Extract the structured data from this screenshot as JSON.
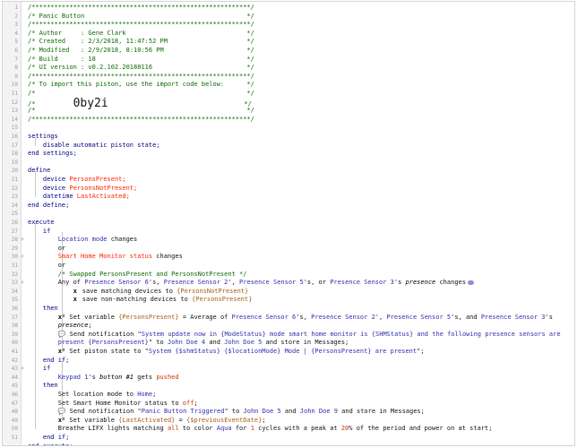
{
  "lines": [
    [
      {
        "c": "c",
        "t": "/**********************************************************/"
      }
    ],
    [
      {
        "c": "c",
        "t": "/* Panic Button                                           */"
      }
    ],
    [
      {
        "c": "c",
        "t": "/**********************************************************/"
      }
    ],
    [
      {
        "c": "c",
        "t": "/* Author     : Gene Clark                                */"
      }
    ],
    [
      {
        "c": "c",
        "t": "/* Created    : 2/3/2018, 11:47:52 PM                     */"
      }
    ],
    [
      {
        "c": "c",
        "t": "/* Modified   : 2/9/2018, 8:10:56 PM                      */"
      }
    ],
    [
      {
        "c": "c",
        "t": "/* Build      : 18                                        */"
      }
    ],
    [
      {
        "c": "c",
        "t": "/* UI version : v0.2.102.20180116                         */"
      }
    ],
    [
      {
        "c": "c",
        "t": "/**********************************************************/"
      }
    ],
    [
      {
        "c": "c",
        "t": "/* To import this piston, use the import code below:      */"
      }
    ],
    [
      {
        "c": "c",
        "t": "/*                                                        */"
      }
    ],
    [
      {
        "c": "c",
        "t": "/*          "
      },
      {
        "c": "big",
        "t": "0by2i"
      },
      {
        "c": "c",
        "t": "                                    */"
      }
    ],
    [
      {
        "c": "c",
        "t": "/*                                                        */"
      }
    ],
    [
      {
        "c": "c",
        "t": "/**********************************************************/"
      }
    ],
    [],
    [
      {
        "c": "k",
        "t": "settings"
      }
    ],
    [
      {
        "c": "t",
        "t": "    "
      },
      {
        "c": "k",
        "t": "disable automatic piston state;"
      }
    ],
    [
      {
        "c": "k",
        "t": "end settings;"
      }
    ],
    [],
    [
      {
        "c": "k",
        "t": "define"
      }
    ],
    [
      {
        "c": "t",
        "t": "    "
      },
      {
        "c": "k",
        "t": "device "
      },
      {
        "c": "v",
        "t": "PersonsPresent;"
      }
    ],
    [
      {
        "c": "t",
        "t": "    "
      },
      {
        "c": "k",
        "t": "device "
      },
      {
        "c": "v",
        "t": "PersonsNotPresent;"
      }
    ],
    [
      {
        "c": "t",
        "t": "    "
      },
      {
        "c": "k",
        "t": "datetime "
      },
      {
        "c": "v",
        "t": "LastActivated;"
      }
    ],
    [
      {
        "c": "k",
        "t": "end define;"
      }
    ],
    [],
    [
      {
        "c": "k",
        "t": "execute"
      }
    ],
    [
      {
        "c": "t",
        "t": "    "
      },
      {
        "c": "k",
        "t": "if"
      }
    ],
    [
      {
        "c": "t",
        "t": "        "
      },
      {
        "c": "d",
        "t": "Location mode"
      },
      {
        "c": "t",
        "t": " changes"
      }
    ],
    [
      {
        "c": "t",
        "t": "        or"
      }
    ],
    [
      {
        "c": "t",
        "t": "        "
      },
      {
        "c": "v",
        "t": "Smart Home Monitor status"
      },
      {
        "c": "t",
        "t": " changes"
      }
    ],
    [
      {
        "c": "t",
        "t": "        or"
      }
    ],
    [
      {
        "c": "t",
        "t": "        "
      },
      {
        "c": "c",
        "t": "/* Swapped PersonsPresent and PersonsNotPresent */"
      }
    ],
    [
      {
        "c": "t",
        "t": "        Any of "
      },
      {
        "c": "d",
        "t": "Presence Sensor 6"
      },
      {
        "c": "t",
        "t": "'s, "
      },
      {
        "c": "d",
        "t": "Presence Sensor 2"
      },
      {
        "c": "t",
        "t": "', "
      },
      {
        "c": "d",
        "t": "Presence Sensor 5"
      },
      {
        "c": "t",
        "t": "'s, or "
      },
      {
        "c": "d",
        "t": "Presence Sensor 3"
      },
      {
        "c": "t",
        "t": "'s "
      },
      {
        "c": "it",
        "t": "presence"
      },
      {
        "c": "t",
        "t": " changes"
      },
      {
        "c": "pill",
        "t": ""
      }
    ],
    [
      {
        "c": "t",
        "t": "            "
      },
      {
        "c": "sym",
        "t": "x"
      },
      {
        "c": "t",
        "t": " save matching devices to "
      },
      {
        "c": "s",
        "t": "{PersonsNotPresent}"
      }
    ],
    [
      {
        "c": "t",
        "t": "            "
      },
      {
        "c": "sym",
        "t": "x"
      },
      {
        "c": "t",
        "t": " save non-matching devices to "
      },
      {
        "c": "s",
        "t": "{PersonsPresent}"
      }
    ],
    [
      {
        "c": "t",
        "t": "    "
      },
      {
        "c": "k",
        "t": "then"
      }
    ],
    [
      {
        "c": "t",
        "t": "        "
      },
      {
        "c": "sym",
        "t": "x²"
      },
      {
        "c": "t",
        "t": " Set variable "
      },
      {
        "c": "s",
        "t": "{PersonsPresent}"
      },
      {
        "c": "t",
        "t": " = Average of "
      },
      {
        "c": "d",
        "t": "Presence Sensor 6"
      },
      {
        "c": "t",
        "t": "'s, "
      },
      {
        "c": "d",
        "t": "Presence Sensor 2"
      },
      {
        "c": "t",
        "t": "', "
      },
      {
        "c": "d",
        "t": "Presence Sensor 5"
      },
      {
        "c": "t",
        "t": "'s, and "
      },
      {
        "c": "d",
        "t": "Presence Sensor 3"
      },
      {
        "c": "t",
        "t": "'s"
      }
    ],
    [
      {
        "c": "t",
        "t": "        "
      },
      {
        "c": "it",
        "t": "presence"
      },
      {
        "c": "t",
        "t": ";"
      }
    ],
    [
      {
        "c": "t",
        "t": "        "
      },
      {
        "c": "sym",
        "t": "💬"
      },
      {
        "c": "t",
        "t": " Send notification \""
      },
      {
        "c": "d",
        "t": "System update now in {ModeStatus} mode smart home monitor is {SHMStatus} and the following presence sensors are"
      }
    ],
    [
      {
        "c": "t",
        "t": "        "
      },
      {
        "c": "d",
        "t": "present {PersonsPresent}"
      },
      {
        "c": "t",
        "t": "\" to "
      },
      {
        "c": "d",
        "t": "John Doe 4"
      },
      {
        "c": "t",
        "t": " and "
      },
      {
        "c": "d",
        "t": "John Doe 5"
      },
      {
        "c": "t",
        "t": " and store in Messages;"
      }
    ],
    [
      {
        "c": "t",
        "t": "        "
      },
      {
        "c": "sym",
        "t": "x²"
      },
      {
        "c": "t",
        "t": " Set piston state to \""
      },
      {
        "c": "d",
        "t": "System {$shmStatus} {$locationMode} Mode | {PersonsPresent} are present"
      },
      {
        "c": "t",
        "t": "\";"
      }
    ],
    [
      {
        "c": "t",
        "t": "    "
      },
      {
        "c": "k",
        "t": "end if;"
      }
    ],
    [
      {
        "c": "t",
        "t": "    "
      },
      {
        "c": "k",
        "t": "if"
      }
    ],
    [
      {
        "c": "t",
        "t": "        "
      },
      {
        "c": "d",
        "t": "Keypad 1"
      },
      {
        "c": "t",
        "t": "'s "
      },
      {
        "c": "it",
        "t": "button #1"
      },
      {
        "c": "t",
        "t": " gets "
      },
      {
        "c": "n",
        "t": "pushed"
      }
    ],
    [
      {
        "c": "t",
        "t": "    "
      },
      {
        "c": "k",
        "t": "then"
      }
    ],
    [
      {
        "c": "t",
        "t": "        Set location mode to "
      },
      {
        "c": "d",
        "t": "Home"
      },
      {
        "c": "t",
        "t": ";"
      }
    ],
    [
      {
        "c": "t",
        "t": "        Set Smart Home Monitor status to "
      },
      {
        "c": "n",
        "t": "off"
      },
      {
        "c": "t",
        "t": ";"
      }
    ],
    [
      {
        "c": "t",
        "t": "        "
      },
      {
        "c": "sym",
        "t": "💬"
      },
      {
        "c": "t",
        "t": " Send notification \""
      },
      {
        "c": "d",
        "t": "Panic Button Triggered"
      },
      {
        "c": "t",
        "t": "\" to "
      },
      {
        "c": "d",
        "t": "John Doe 5"
      },
      {
        "c": "t",
        "t": " and "
      },
      {
        "c": "d",
        "t": "John Doe 9"
      },
      {
        "c": "t",
        "t": " and store in Messages;"
      }
    ],
    [
      {
        "c": "t",
        "t": "        "
      },
      {
        "c": "sym",
        "t": "x²"
      },
      {
        "c": "t",
        "t": " Set variable "
      },
      {
        "c": "s",
        "t": "{LastActivated}"
      },
      {
        "c": "t",
        "t": " = "
      },
      {
        "c": "s",
        "t": "{$previousEventDate}"
      },
      {
        "c": "t",
        "t": ";"
      }
    ],
    [
      {
        "c": "t",
        "t": "        Breathe LIFX lights matching "
      },
      {
        "c": "n",
        "t": "all"
      },
      {
        "c": "t",
        "t": " to color "
      },
      {
        "c": "d",
        "t": "Aqua"
      },
      {
        "c": "t",
        "t": " for "
      },
      {
        "c": "n",
        "t": "1"
      },
      {
        "c": "t",
        "t": " cycles with a peak at "
      },
      {
        "c": "n",
        "t": "20"
      },
      {
        "c": "t",
        "t": "% of the period and power on at start;"
      }
    ],
    [
      {
        "c": "t",
        "t": "    "
      },
      {
        "c": "k",
        "t": "end if;"
      }
    ],
    [
      {
        "c": "k",
        "t": "end execute;"
      }
    ]
  ],
  "line_numbers": [
    "1",
    "2",
    "3",
    "4",
    "5",
    "6",
    "7",
    "8",
    "9",
    "10",
    "11",
    "12",
    "13",
    "14",
    "15",
    "16",
    "17",
    "18",
    "19",
    "20",
    "21",
    "22",
    "23",
    "24",
    "25",
    "26",
    "27",
    "28",
    "29",
    "30",
    "31",
    "32",
    "33",
    "34",
    "35",
    "36",
    "37",
    "38",
    "39",
    "40",
    "41",
    "42",
    "43",
    "44",
    "45",
    "46",
    "47",
    "48",
    "49",
    "50",
    "51"
  ],
  "trigger_marks": {
    "28": "⚡",
    "30": "⚡",
    "33": "⚡",
    "43": "⚡"
  },
  "colors": {
    "comment": "#0a6a00",
    "keyword": "#000080",
    "variable": "#ff2200",
    "expression": "#a85a10",
    "device": "#2f2fb0",
    "value": "#cc3300",
    "gutter": "#f3f3f3",
    "trigger_mark": "#e0531e"
  }
}
